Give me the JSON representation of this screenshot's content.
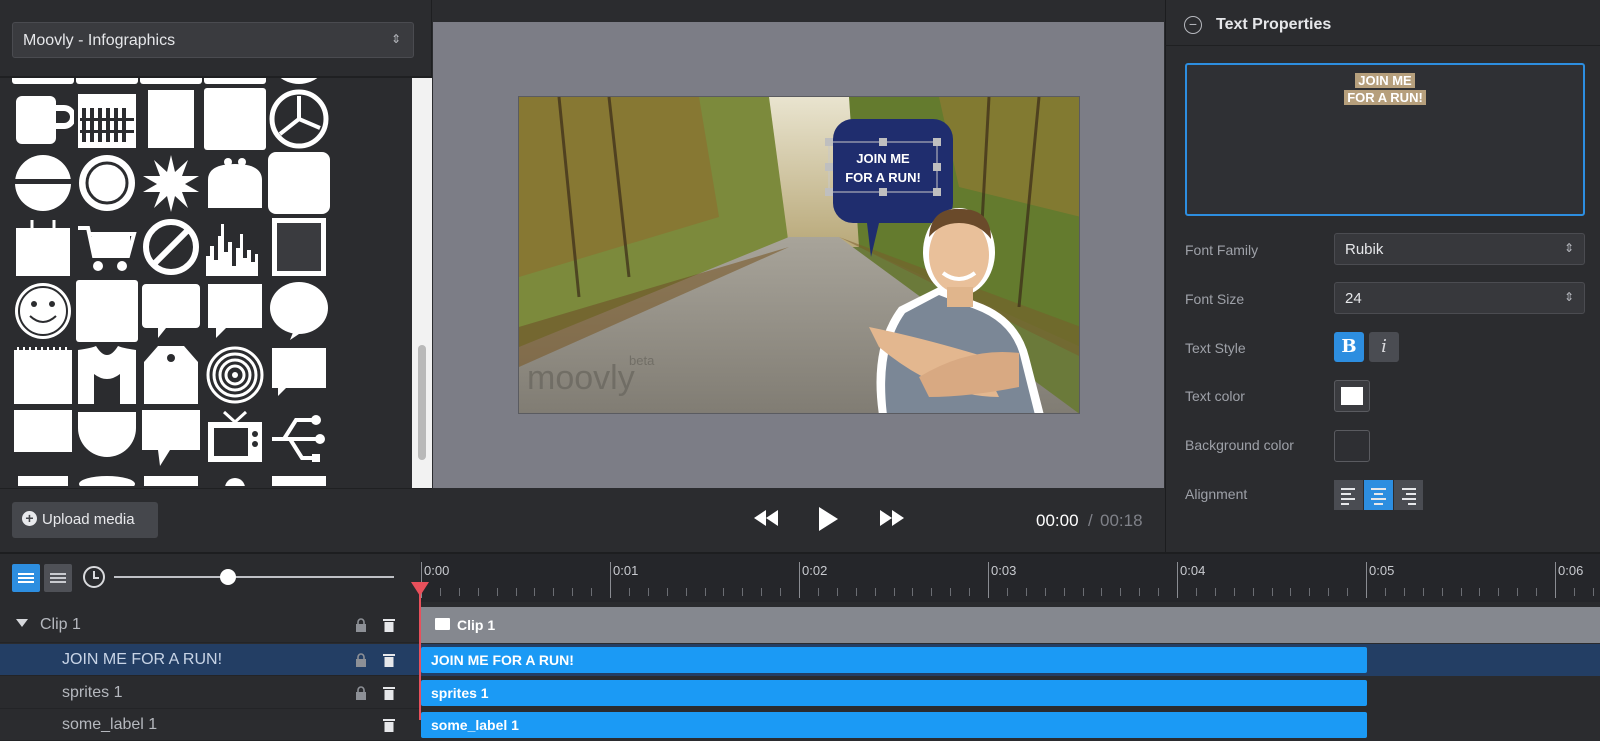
{
  "library": {
    "selected": "Moovly - Infographics",
    "upload_label": "Upload media"
  },
  "player": {
    "current_time": "00:00",
    "separator": "/",
    "total_time": "00:18"
  },
  "canvas": {
    "bubble_line1": "JOIN ME",
    "bubble_line2": "FOR A RUN!",
    "watermark_logo": "moovly",
    "watermark_beta": "beta"
  },
  "properties": {
    "title": "Text Properties",
    "preview_line1": "JOIN ME",
    "preview_line2": "FOR A RUN!",
    "font_family_label": "Font Family",
    "font_family_value": "Rubik",
    "font_size_label": "Font Size",
    "font_size_value": "24",
    "text_style_label": "Text Style",
    "bold_label": "B",
    "italic_label": "i",
    "text_color_label": "Text color",
    "text_color_value": "#ffffff",
    "bg_color_label": "Background color",
    "alignment_label": "Alignment",
    "alignment_selected": "center"
  },
  "timeline": {
    "ticks": [
      "0:00",
      "0:01",
      "0:02",
      "0:03",
      "0:04",
      "0:05",
      "0:06"
    ],
    "layers": [
      {
        "name": "Clip 1",
        "bar": "Clip 1"
      },
      {
        "name": "JOIN ME FOR A RUN!",
        "bar": "JOIN ME FOR A RUN!"
      },
      {
        "name": "sprites 1",
        "bar": "sprites 1"
      },
      {
        "name": "some_label 1",
        "bar": "some_label 1"
      }
    ]
  },
  "colors": {
    "accent": "#2d8ee0",
    "bar": "#1b9af5",
    "playhead": "#e8505b",
    "bubble": "#1f2d6e"
  }
}
